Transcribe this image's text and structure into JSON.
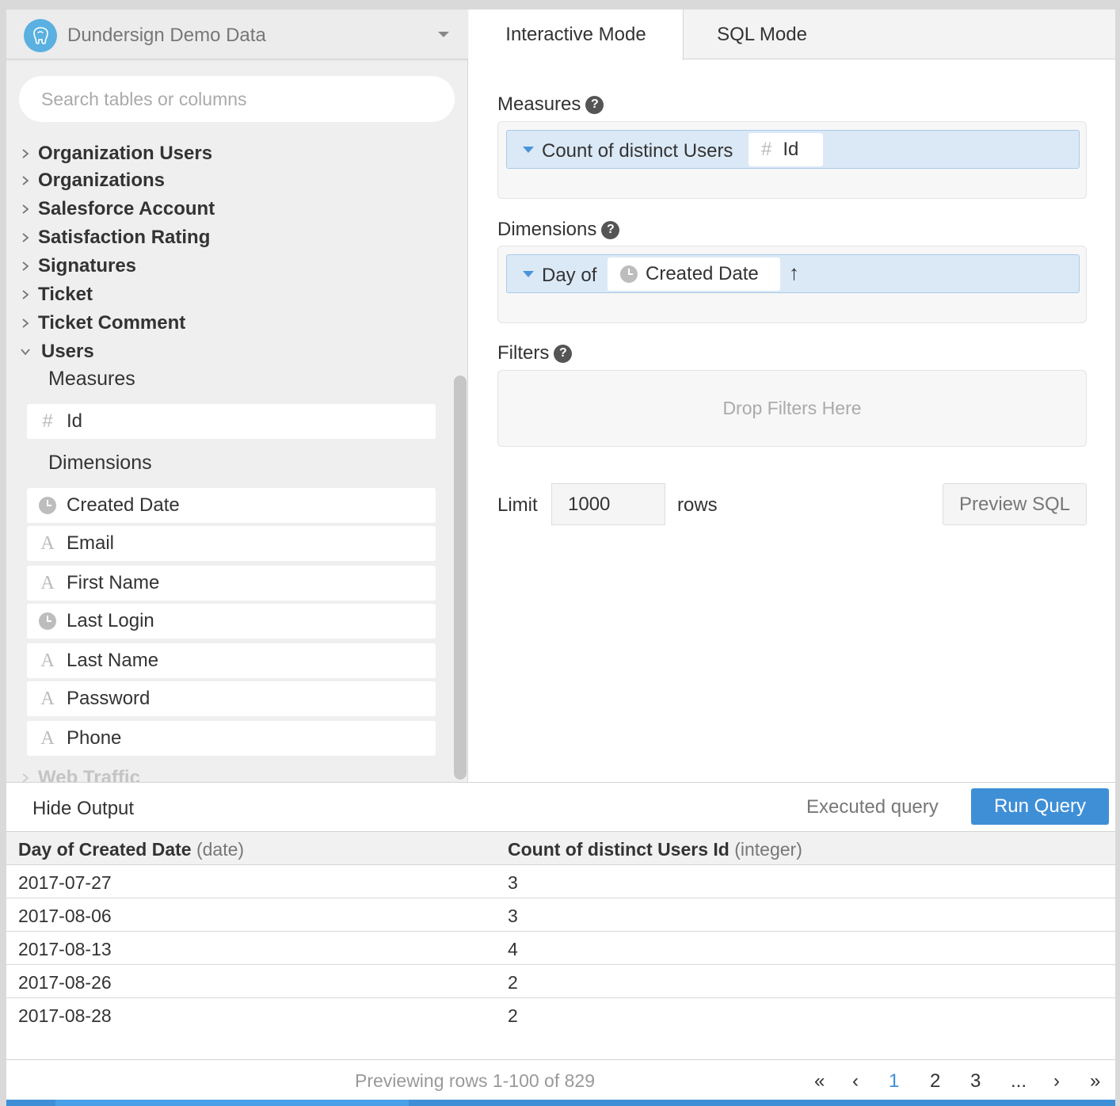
{
  "datasource": {
    "name": "Dundersign Demo Data"
  },
  "search": {
    "placeholder": "Search tables or columns"
  },
  "tables": [
    {
      "label": "Organization Users"
    },
    {
      "label": "Organizations"
    },
    {
      "label": "Salesforce Account"
    },
    {
      "label": "Satisfaction Rating"
    },
    {
      "label": "Signatures"
    },
    {
      "label": "Ticket"
    },
    {
      "label": "Ticket Comment"
    },
    {
      "label": "Users"
    },
    {
      "label": "Web Traffic"
    }
  ],
  "users_table": {
    "measures_heading": "Measures",
    "measures": [
      {
        "label": "Id",
        "icon": "hash-icon"
      }
    ],
    "dimensions_heading": "Dimensions",
    "dimensions": [
      {
        "label": "Created Date",
        "icon": "clock-icon"
      },
      {
        "label": "Email",
        "icon": "text-icon"
      },
      {
        "label": "First Name",
        "icon": "text-icon"
      },
      {
        "label": "Last Login",
        "icon": "clock-icon"
      },
      {
        "label": "Last Name",
        "icon": "text-icon"
      },
      {
        "label": "Password",
        "icon": "text-icon"
      },
      {
        "label": "Phone",
        "icon": "text-icon"
      }
    ],
    "hash_glyph": "#",
    "text_glyph": "A"
  },
  "tabs": {
    "interactive": "Interactive Mode",
    "sql": "SQL Mode"
  },
  "builder": {
    "measures_label": "Measures",
    "measure_pill": {
      "prefix": "Count of distinct Users",
      "field": "Id"
    },
    "dimensions_label": "Dimensions",
    "dimension_pill": {
      "prefix": "Day of",
      "field": "Created Date",
      "sort": "↑"
    },
    "filters_label": "Filters",
    "filters_placeholder": "Drop Filters Here",
    "help_glyph": "?",
    "limit_label": "Limit",
    "limit_value": "1000",
    "rows_label": "rows",
    "preview_sql": "Preview SQL"
  },
  "output": {
    "hide": "Hide Output",
    "status": "Executed query",
    "run": "Run Query"
  },
  "results": {
    "columns": [
      {
        "name": "Day of Created Date",
        "type": "(date)"
      },
      {
        "name": "Count of distinct Users Id",
        "type": "(integer)"
      }
    ],
    "rows": [
      [
        "2017-07-27",
        "3"
      ],
      [
        "2017-08-06",
        "3"
      ],
      [
        "2017-08-13",
        "4"
      ],
      [
        "2017-08-26",
        "2"
      ],
      [
        "2017-08-28",
        "2"
      ]
    ]
  },
  "pager": {
    "info": "Previewing rows 1-100 of 829",
    "first": "«",
    "prev": "‹",
    "pages": [
      "1",
      "2",
      "3"
    ],
    "ellipsis": "...",
    "next": "›",
    "last": "»"
  },
  "colors": {
    "accent": "#3e8fd6",
    "pill_bg": "#dbe9f7",
    "logo": "#5ab0e0"
  }
}
